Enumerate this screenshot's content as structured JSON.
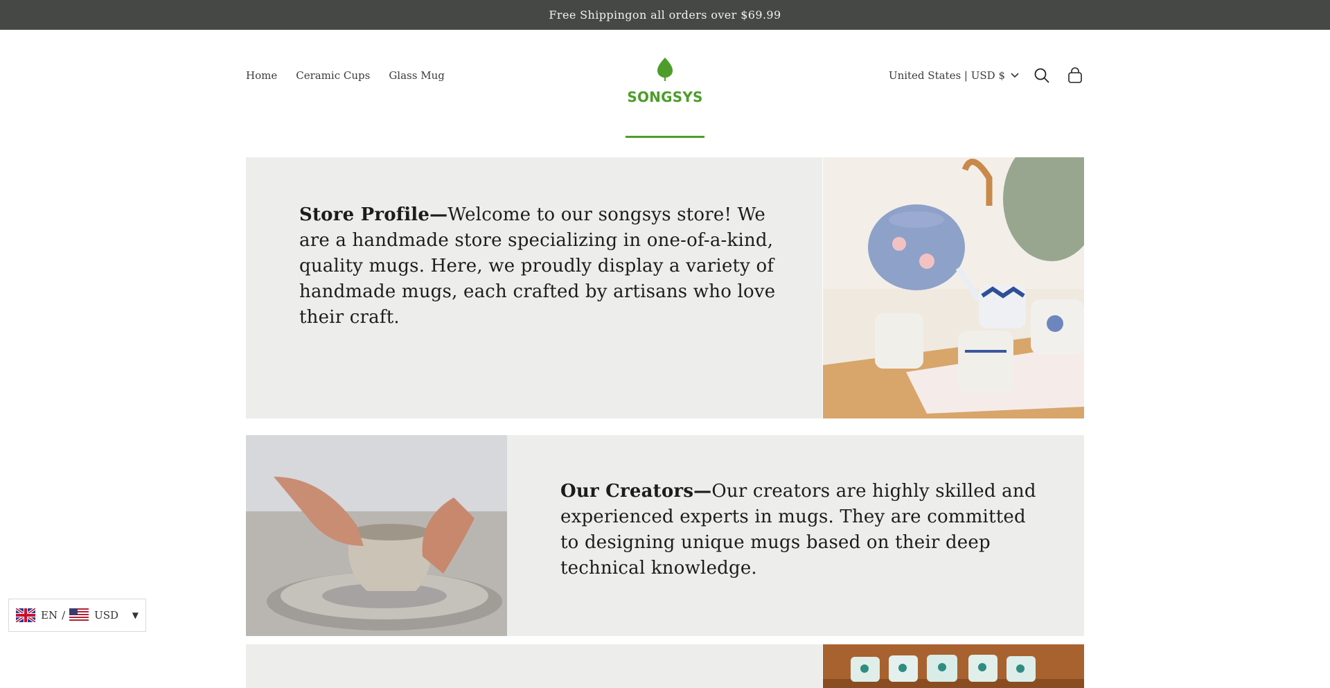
{
  "announcement": {
    "text": "Free Shippingon all orders over $69.99"
  },
  "header": {
    "nav": [
      {
        "label": "Home"
      },
      {
        "label": "Ceramic Cups"
      },
      {
        "label": "Glass Mug"
      }
    ],
    "logo_text": "SONGSYS",
    "country_selector": "United States | USD $",
    "icons": [
      "search-icon",
      "cart-icon"
    ]
  },
  "sections": [
    {
      "heading": "Store Profile—",
      "body": "Welcome to our songsys store! We are a handmade store specializing in one-of-a-kind, quality mugs. Here, we proudly display a variety of handmade mugs, each crafted by artisans who love their craft.",
      "image": "teapot-pouring-tea-photo"
    },
    {
      "heading": "Our Creators—",
      "body": "Our creators are highly skilled and experienced experts in mugs. They are committed to designing unique mugs based on their deep technical knowledge.",
      "image": "potter-at-wheel-photo"
    },
    {
      "heading": "",
      "body": "",
      "image": "mugs-on-shelf-photo"
    }
  ],
  "switcher": {
    "language": "EN",
    "separator": "/",
    "currency": "USD"
  },
  "colors": {
    "announcement_bg": "#464846",
    "panel_bg": "#ededeb",
    "brand_green": "#4d9d2a"
  }
}
